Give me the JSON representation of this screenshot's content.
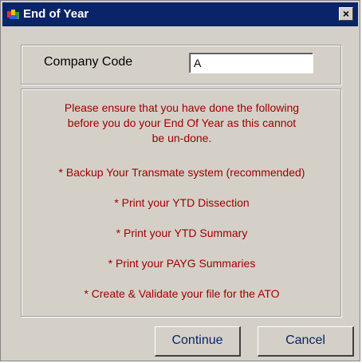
{
  "window": {
    "title": "End of Year",
    "close_glyph": "×"
  },
  "company": {
    "label": "Company Code",
    "value": "A"
  },
  "message": {
    "intro_lines": [
      "Please ensure that you have done the following",
      "before you do your End Of Year as this cannot",
      "be un-done."
    ],
    "items": [
      "* Backup Your Transmate system (recommended)",
      "* Print your YTD Dissection",
      "* Print your YTD Summary",
      "* Print your PAYG Summaries",
      "* Create & Validate your file for the ATO"
    ]
  },
  "buttons": {
    "continue_label": "Continue",
    "cancel_label": "Cancel"
  },
  "colors": {
    "title_bar": "#0a246a",
    "dialog_bg": "#d4d0c8",
    "message_text": "#a00000",
    "button_text": "#0a246a"
  },
  "icons": {
    "app_icon": "application-icon",
    "close_icon": "close-icon"
  }
}
